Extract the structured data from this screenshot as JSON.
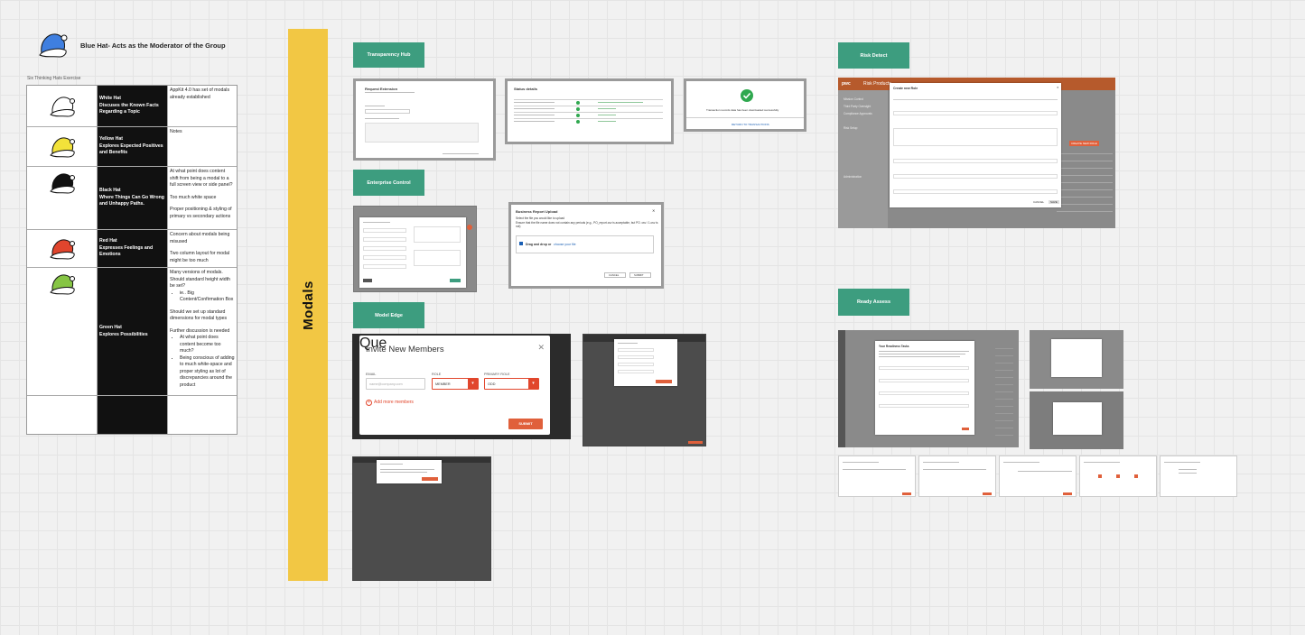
{
  "header": {
    "title": "Blue Hat- Acts as the Moderator of the Group",
    "subtitle": "Six Thinking Hats Exercise"
  },
  "colors": {
    "blue_hat": "#3f7fe0",
    "white_hat": "#ffffff",
    "yellow_hat": "#f2e23a",
    "black_hat": "#111111",
    "red_hat": "#e0452d",
    "green_hat": "#86c544",
    "banner": "#f2c744",
    "section_label": "#3d9d7f",
    "accent": "#e0603b"
  },
  "hats": [
    {
      "icon": "white-hat-icon",
      "name": "White Hat",
      "desc": "Discuses the Known Facts Regarding a Topic",
      "notes": [
        "AppKit 4.0 has set of modals already established"
      ]
    },
    {
      "icon": "yellow-hat-icon",
      "name": "Yellow Hat",
      "desc": "Explores Expected Positives and Benefits",
      "notes": [
        "Notes"
      ]
    },
    {
      "icon": "black-hat-icon",
      "name": "Black Hat",
      "desc": "Where Things Can Go Wrong and Unhappy Paths.",
      "notes": [
        "At what point does content shift from being a modal to a full screen view or side panel?",
        "Too much white space",
        "Proper positioning & styling of primary vs secondary actions"
      ]
    },
    {
      "icon": "red-hat-icon",
      "name": "Red Hat",
      "desc": "Expresses Feelings and Emotions",
      "notes": [
        "Concern about modals being misused",
        "Two column layout for modal might be too much"
      ]
    },
    {
      "icon": "green-hat-icon",
      "name": "Green Hat",
      "desc": "Explores Possibilities",
      "notes": [
        "Many versions of modals. Should standard height width be set?",
        "Should we set up standard dimensions for modal types",
        "Further discussion is needed"
      ],
      "bullets_a": [
        "ie.. Big Content/Confirmation Box"
      ],
      "bullets_b": [
        "At what point does content become too much?",
        "Being conscious of adding to much white-space and proper styling as lot of discrepancies around the product"
      ]
    }
  ],
  "banner": {
    "label": "Modals"
  },
  "sections": {
    "transparency": "Transparency Hub",
    "enterprise": "Enterprise Control",
    "model_edge": "Model Edge",
    "risk_detect": "Risk Detect",
    "ready_assess": "Ready Assess"
  },
  "transparency_modals": {
    "m1_title": "Request Extension",
    "m2_title": "Status details",
    "m3_text": "Transaction records data has been downloaded successfully",
    "m3_link": "RETURN TO TRANSACTIONS"
  },
  "upload_modal": {
    "title": "Business Report Upload",
    "line1": "Select the file you would like to upload",
    "line2": "Ensure that the file name does not contain any periods (e.g., PO_report.csv is acceptable, but PO. csv / 1.csv is not)",
    "drop": "Drag and drop or",
    "browse": "choose your file",
    "cancel": "CANCEL",
    "submit": "SUBMIT"
  },
  "invite_modal": {
    "title": "Invite New Members",
    "email_label": "EMAIL",
    "email_placeholder": "name@company.com",
    "role_label": "ROLE",
    "role_value": "MEMBER",
    "primary_role_label": "PRIMARY ROLE",
    "primary_role_value": "ODD",
    "add_more": "Add more members",
    "submit": "SUBMIT",
    "bg_text": "Que"
  },
  "risk_app": {
    "brand": "pwc",
    "product": "Risk Products",
    "modal_title": "Create new Role",
    "nav": [
      "Mission Control",
      "Third Party Oversight",
      "Compliance Approvals",
      "Risk Setup",
      "Administration"
    ],
    "create_button": "CREATE NEW ROLE",
    "save": "SAVE",
    "cancel": "CANCEL"
  },
  "ready_assess": {
    "modal_title": "Your Readiness Tasks"
  }
}
